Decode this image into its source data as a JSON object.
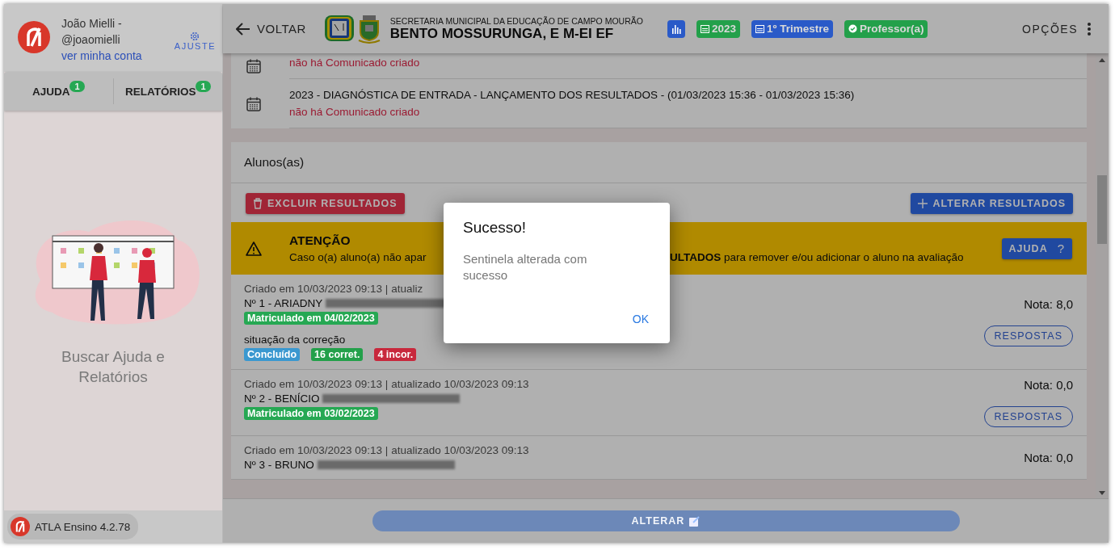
{
  "sidebar": {
    "user_name": "João Mielli -",
    "user_handle": "@joaomielli",
    "account_link": "ver minha conta",
    "settings_button": "AJUSTE",
    "tabs": [
      {
        "label": "AJUDA",
        "badge": "1"
      },
      {
        "label": "RELATÓRIOS",
        "badge": "1"
      }
    ],
    "help_text": "Buscar Ajuda e Relatórios",
    "version": "ATLA Ensino 4.2.78"
  },
  "header": {
    "back": "VOLTAR",
    "subtitle": "SECRETARIA MUNICIPAL DA EDUCAÇÃO DE CAMPO MOURÃO",
    "title": "BENTO MOSSURUNGA, E M-EI EF",
    "chips": [
      {
        "kind": "chart",
        "color": "#2a5ac8"
      },
      {
        "kind": "calendar",
        "label": "2023",
        "color": "#23a04a"
      },
      {
        "kind": "calendar",
        "label": "1º Trimestre",
        "color": "#2a5ac8"
      },
      {
        "kind": "check",
        "label": "Professor(a)",
        "color": "#23a04a"
      }
    ],
    "options": "OPÇÕES"
  },
  "events": [
    {
      "status": "não há Comunicado criado"
    },
    {
      "title": "2023 - DIAGNÓSTICA DE ENTRADA - LANÇAMENTO DOS RESULTADOS - (01/03/2023 15:36 - 01/03/2023 15:36)",
      "status": "não há Comunicado criado"
    }
  ],
  "students_card": {
    "title": "Alunos(as)",
    "delete_button": "EXCLUIR RESULTADOS",
    "change_button": "ALTERAR RESULTADOS",
    "alert": {
      "title": "ATENÇÃO",
      "text_left": "Caso o(a) aluno(a) não apar",
      "text_right": "**ULTADOS** para remover e/ou adicionar o aluno na avaliação",
      "help_button": "AJUDA",
      "help_icon": "?"
    },
    "students": [
      {
        "meta": "Criado em 10/03/2023 09:13 | atualiz",
        "name": "Nº 1 - ARIADNY",
        "enrolled": "Matriculado em 04/02/2023",
        "correction_label": "situação da correção",
        "tags": [
          {
            "label": "Concluído",
            "color": "#3a98d0"
          },
          {
            "label": "16 corret.",
            "color": "#23a04a"
          },
          {
            "label": "4 incor.",
            "color": "#c8283c"
          }
        ],
        "grade": "Nota: 8,0",
        "answers_button": "RESPOSTAS"
      },
      {
        "meta": "Criado em 10/03/2023 09:13 | atualizado 10/03/2023 09:13",
        "name": "Nº 2 - BENÍCIO",
        "enrolled": "Matriculado em 03/02/2023",
        "grade": "Nota: 0,0",
        "answers_button": "RESPOSTAS"
      },
      {
        "meta": "Criado em 10/03/2023 09:13 | atualizado 10/03/2023 09:13",
        "name": "Nº 3 - BRUNO",
        "grade": "Nota: 0,0"
      }
    ]
  },
  "footer": {
    "button": "ALTERAR",
    "disabled": true
  },
  "dialog": {
    "title": "Sucesso!",
    "message": "Sentinela alterada com sucesso",
    "ok": "OK"
  }
}
